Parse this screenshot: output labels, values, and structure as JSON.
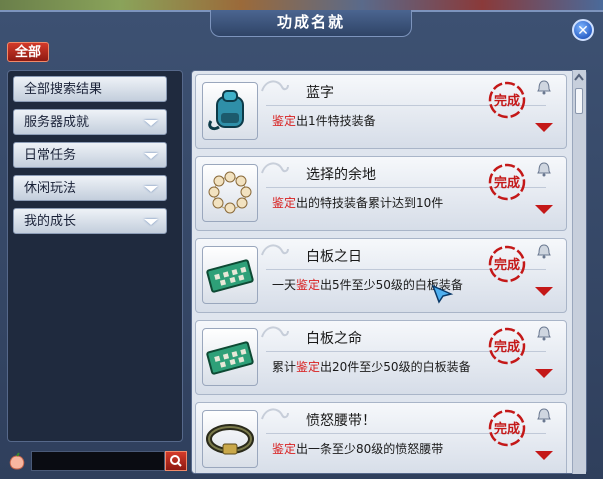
{
  "window": {
    "title": "功成名就"
  },
  "filter_all_label": "全部",
  "sidebar": {
    "items": [
      {
        "label": "全部搜索结果",
        "has_dropdown": false
      },
      {
        "label": "服务器成就",
        "has_dropdown": true
      },
      {
        "label": "日常任务",
        "has_dropdown": true
      },
      {
        "label": "休闲玩法",
        "has_dropdown": true
      },
      {
        "label": "我的成长",
        "has_dropdown": true
      }
    ]
  },
  "search": {
    "value": "",
    "placeholder": ""
  },
  "achievements": [
    {
      "name": "蓝字",
      "desc_pre": "",
      "desc_hl": "鉴定",
      "desc_post": "出1件特技装备",
      "stamp": "完成",
      "icon": "backpack-icon"
    },
    {
      "name": "选择的余地",
      "desc_pre": "",
      "desc_hl": "鉴定",
      "desc_post": "出的特技装备累计达到10件",
      "stamp": "完成",
      "icon": "pearl-bracelet-icon"
    },
    {
      "name": "白板之日",
      "desc_pre": "一天",
      "desc_hl": "鉴定",
      "desc_post": "出5件至少50级的白板装备",
      "stamp": "完成",
      "icon": "circuit-board-icon"
    },
    {
      "name": "白板之命",
      "desc_pre": "累计",
      "desc_hl": "鉴定",
      "desc_post": "出20件至少50级的白板装备",
      "stamp": "完成",
      "icon": "circuit-board-icon"
    },
    {
      "name": "愤怒腰带！",
      "desc_pre": "",
      "desc_hl": "鉴定",
      "desc_post": "出一条至少80级的愤怒腰带",
      "stamp": "完成",
      "icon": "belt-icon"
    }
  ],
  "colors": {
    "highlight": "#d82020",
    "stamp": "#c41818",
    "accent": "#2d63c9"
  }
}
